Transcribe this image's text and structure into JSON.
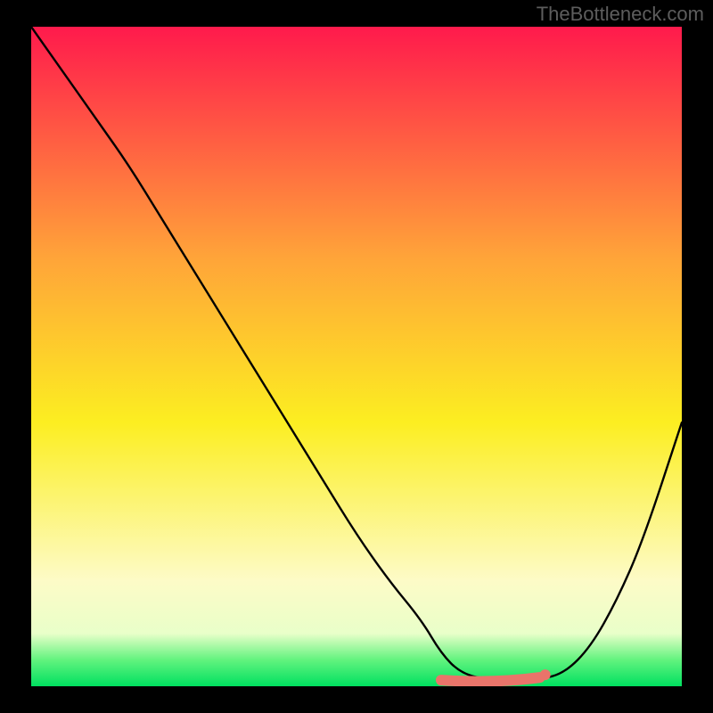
{
  "watermark": "TheBottleneck.com",
  "chart_data": {
    "type": "line",
    "title": "",
    "xlabel": "",
    "ylabel": "",
    "xlim": [
      0,
      100
    ],
    "ylim": [
      0,
      100
    ],
    "gradient_stops": [
      {
        "offset": 0,
        "color": "#ff1a4c"
      },
      {
        "offset": 35,
        "color": "#ffa439"
      },
      {
        "offset": 60,
        "color": "#fcee21"
      },
      {
        "offset": 84,
        "color": "#fdfbc7"
      },
      {
        "offset": 92,
        "color": "#e9ffc9"
      },
      {
        "offset": 96,
        "color": "#62f37e"
      },
      {
        "offset": 100,
        "color": "#00e060"
      }
    ],
    "series": [
      {
        "name": "bottleneck-curve",
        "x": [
          0,
          5,
          10,
          15,
          20,
          25,
          30,
          35,
          40,
          45,
          50,
          55,
          60,
          63,
          66,
          70,
          74,
          78,
          82,
          86,
          90,
          94,
          100
        ],
        "y": [
          100,
          93,
          86,
          79,
          71,
          63,
          55,
          47,
          39,
          31,
          23,
          16,
          10,
          5,
          2,
          1,
          1,
          1,
          2,
          6,
          13,
          22,
          40
        ]
      }
    ],
    "highlight_band": {
      "name": "optimal-range",
      "x_start": 63,
      "x_end": 79,
      "y": 1.2,
      "color": "#e9746a"
    }
  }
}
